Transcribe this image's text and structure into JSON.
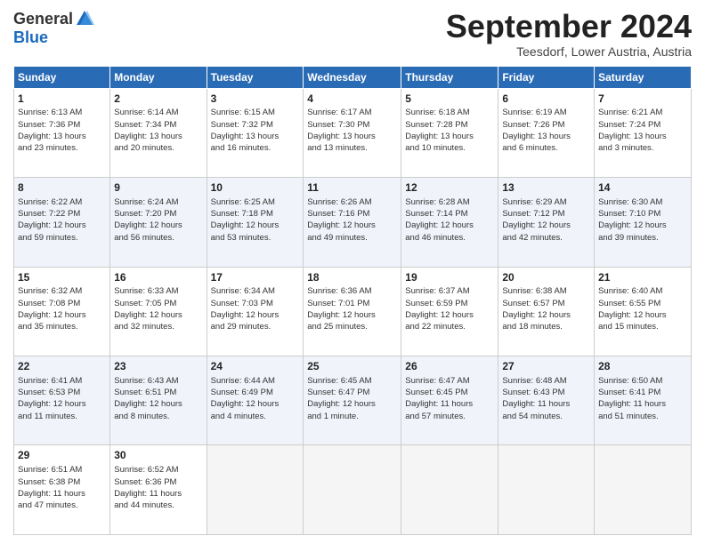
{
  "logo": {
    "general": "General",
    "blue": "Blue"
  },
  "title": "September 2024",
  "location": "Teesdorf, Lower Austria, Austria",
  "days_of_week": [
    "Sunday",
    "Monday",
    "Tuesday",
    "Wednesday",
    "Thursday",
    "Friday",
    "Saturday"
  ],
  "weeks": [
    [
      {
        "day": "1",
        "info": "Sunrise: 6:13 AM\nSunset: 7:36 PM\nDaylight: 13 hours\nand 23 minutes."
      },
      {
        "day": "2",
        "info": "Sunrise: 6:14 AM\nSunset: 7:34 PM\nDaylight: 13 hours\nand 20 minutes."
      },
      {
        "day": "3",
        "info": "Sunrise: 6:15 AM\nSunset: 7:32 PM\nDaylight: 13 hours\nand 16 minutes."
      },
      {
        "day": "4",
        "info": "Sunrise: 6:17 AM\nSunset: 7:30 PM\nDaylight: 13 hours\nand 13 minutes."
      },
      {
        "day": "5",
        "info": "Sunrise: 6:18 AM\nSunset: 7:28 PM\nDaylight: 13 hours\nand 10 minutes."
      },
      {
        "day": "6",
        "info": "Sunrise: 6:19 AM\nSunset: 7:26 PM\nDaylight: 13 hours\nand 6 minutes."
      },
      {
        "day": "7",
        "info": "Sunrise: 6:21 AM\nSunset: 7:24 PM\nDaylight: 13 hours\nand 3 minutes."
      }
    ],
    [
      {
        "day": "8",
        "info": "Sunrise: 6:22 AM\nSunset: 7:22 PM\nDaylight: 12 hours\nand 59 minutes."
      },
      {
        "day": "9",
        "info": "Sunrise: 6:24 AM\nSunset: 7:20 PM\nDaylight: 12 hours\nand 56 minutes."
      },
      {
        "day": "10",
        "info": "Sunrise: 6:25 AM\nSunset: 7:18 PM\nDaylight: 12 hours\nand 53 minutes."
      },
      {
        "day": "11",
        "info": "Sunrise: 6:26 AM\nSunset: 7:16 PM\nDaylight: 12 hours\nand 49 minutes."
      },
      {
        "day": "12",
        "info": "Sunrise: 6:28 AM\nSunset: 7:14 PM\nDaylight: 12 hours\nand 46 minutes."
      },
      {
        "day": "13",
        "info": "Sunrise: 6:29 AM\nSunset: 7:12 PM\nDaylight: 12 hours\nand 42 minutes."
      },
      {
        "day": "14",
        "info": "Sunrise: 6:30 AM\nSunset: 7:10 PM\nDaylight: 12 hours\nand 39 minutes."
      }
    ],
    [
      {
        "day": "15",
        "info": "Sunrise: 6:32 AM\nSunset: 7:08 PM\nDaylight: 12 hours\nand 35 minutes."
      },
      {
        "day": "16",
        "info": "Sunrise: 6:33 AM\nSunset: 7:05 PM\nDaylight: 12 hours\nand 32 minutes."
      },
      {
        "day": "17",
        "info": "Sunrise: 6:34 AM\nSunset: 7:03 PM\nDaylight: 12 hours\nand 29 minutes."
      },
      {
        "day": "18",
        "info": "Sunrise: 6:36 AM\nSunset: 7:01 PM\nDaylight: 12 hours\nand 25 minutes."
      },
      {
        "day": "19",
        "info": "Sunrise: 6:37 AM\nSunset: 6:59 PM\nDaylight: 12 hours\nand 22 minutes."
      },
      {
        "day": "20",
        "info": "Sunrise: 6:38 AM\nSunset: 6:57 PM\nDaylight: 12 hours\nand 18 minutes."
      },
      {
        "day": "21",
        "info": "Sunrise: 6:40 AM\nSunset: 6:55 PM\nDaylight: 12 hours\nand 15 minutes."
      }
    ],
    [
      {
        "day": "22",
        "info": "Sunrise: 6:41 AM\nSunset: 6:53 PM\nDaylight: 12 hours\nand 11 minutes."
      },
      {
        "day": "23",
        "info": "Sunrise: 6:43 AM\nSunset: 6:51 PM\nDaylight: 12 hours\nand 8 minutes."
      },
      {
        "day": "24",
        "info": "Sunrise: 6:44 AM\nSunset: 6:49 PM\nDaylight: 12 hours\nand 4 minutes."
      },
      {
        "day": "25",
        "info": "Sunrise: 6:45 AM\nSunset: 6:47 PM\nDaylight: 12 hours\nand 1 minute."
      },
      {
        "day": "26",
        "info": "Sunrise: 6:47 AM\nSunset: 6:45 PM\nDaylight: 11 hours\nand 57 minutes."
      },
      {
        "day": "27",
        "info": "Sunrise: 6:48 AM\nSunset: 6:43 PM\nDaylight: 11 hours\nand 54 minutes."
      },
      {
        "day": "28",
        "info": "Sunrise: 6:50 AM\nSunset: 6:41 PM\nDaylight: 11 hours\nand 51 minutes."
      }
    ],
    [
      {
        "day": "29",
        "info": "Sunrise: 6:51 AM\nSunset: 6:38 PM\nDaylight: 11 hours\nand 47 minutes."
      },
      {
        "day": "30",
        "info": "Sunrise: 6:52 AM\nSunset: 6:36 PM\nDaylight: 11 hours\nand 44 minutes."
      },
      {
        "day": "",
        "info": ""
      },
      {
        "day": "",
        "info": ""
      },
      {
        "day": "",
        "info": ""
      },
      {
        "day": "",
        "info": ""
      },
      {
        "day": "",
        "info": ""
      }
    ]
  ]
}
